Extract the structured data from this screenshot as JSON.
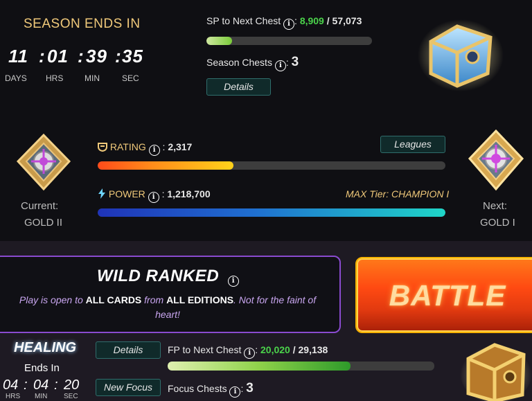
{
  "season": {
    "title": "SEASON ENDS IN",
    "timer": {
      "days": "11",
      "hrs": "01",
      "min": "39",
      "sec": "35",
      "sep": ":"
    },
    "labels": {
      "days": "DAYS",
      "hrs": "HRS",
      "min": "MIN",
      "sec": "SEC"
    }
  },
  "season_progress": {
    "label": "SP to Next Chest",
    "current": "8,909",
    "sep": "/",
    "total": "57,073",
    "progress": 0.156,
    "chests_label": "Season Chests",
    "chests_value": "3",
    "details_label": "Details"
  },
  "league": {
    "rating_label": "RATING",
    "rating_colon": ":",
    "rating_value": "2,317",
    "rating_progress": 0.39,
    "power_label": "POWER",
    "power_colon": ":",
    "power_value": "1,218,700",
    "power_progress": 1.0,
    "leagues_button": "Leagues",
    "max_tier": "MAX Tier: CHAMPION I",
    "current_label": "Current:",
    "current_value": "GOLD II",
    "next_label": "Next:",
    "next_value": "GOLD I"
  },
  "mode": {
    "title": "WILD RANKED",
    "desc_1": "Play is open to ",
    "desc_2": "ALL CARDS",
    "desc_3": " from ",
    "desc_4": "ALL EDITIONS",
    "desc_5": ". Not for the faint of",
    "desc_6": "heart!"
  },
  "battle": {
    "label": "BATTLE"
  },
  "focus": {
    "name": "HEALING",
    "ends_label": "Ends In",
    "timer": {
      "hrs": "04",
      "min": "04",
      "sec": "20",
      "sep": ":"
    },
    "labels": {
      "hrs": "HRS",
      "min": "MIN",
      "sec": "SEC"
    },
    "details_label": "Details",
    "new_focus_label": "New Focus",
    "fp_label": "FP to Next Chest",
    "fp_current": "20,020",
    "fp_sep": "/",
    "fp_total": "29,138",
    "fp_progress": 0.687,
    "chests_label": "Focus Chests",
    "chests_value": "3"
  },
  "colors": {
    "accent_gold": "#f0c97a",
    "value_green": "#4bd34b",
    "mode_border": "#8a4bd0",
    "battle_orange": "#ff5a16"
  },
  "icons": [
    "season-chest-icon",
    "gold-ii-league-icon",
    "gold-i-league-icon",
    "rating-shield-icon",
    "power-bolt-icon",
    "info-icon",
    "focus-chest-icon"
  ]
}
